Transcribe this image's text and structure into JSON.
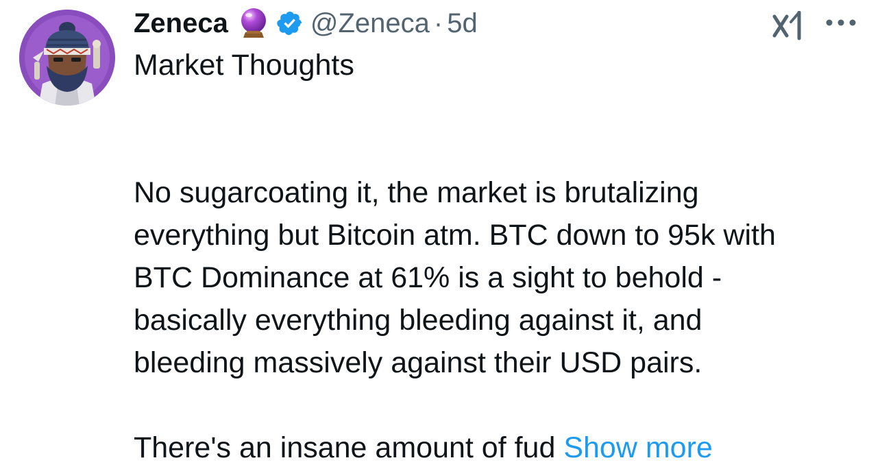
{
  "user": {
    "display_name": "Zeneca",
    "handle": "@Zeneca",
    "separator": "·",
    "time": "5d"
  },
  "icons": {
    "avatar": "avatar-image",
    "emoji": "crystal-ball-icon",
    "verified": "verified-badge-icon",
    "grok": "grok-icon",
    "more": "more-options-icon"
  },
  "colors": {
    "text": "#0f1419",
    "secondary": "#536471",
    "link": "#1d9bf0",
    "verified": "#1d9bf0"
  },
  "tweet": {
    "title": "Market Thoughts",
    "lines": [
      "No sugarcoating it, the market is brutalizing",
      "everything but Bitcoin atm. BTC down to 95k with",
      "BTC Dominance at 61% is a sight to behold -",
      "basically everything bleeding against it, and",
      "bleeding massively against their USD pairs."
    ],
    "last_line": "There's an insane amount of fud",
    "show_more": "Show more"
  }
}
